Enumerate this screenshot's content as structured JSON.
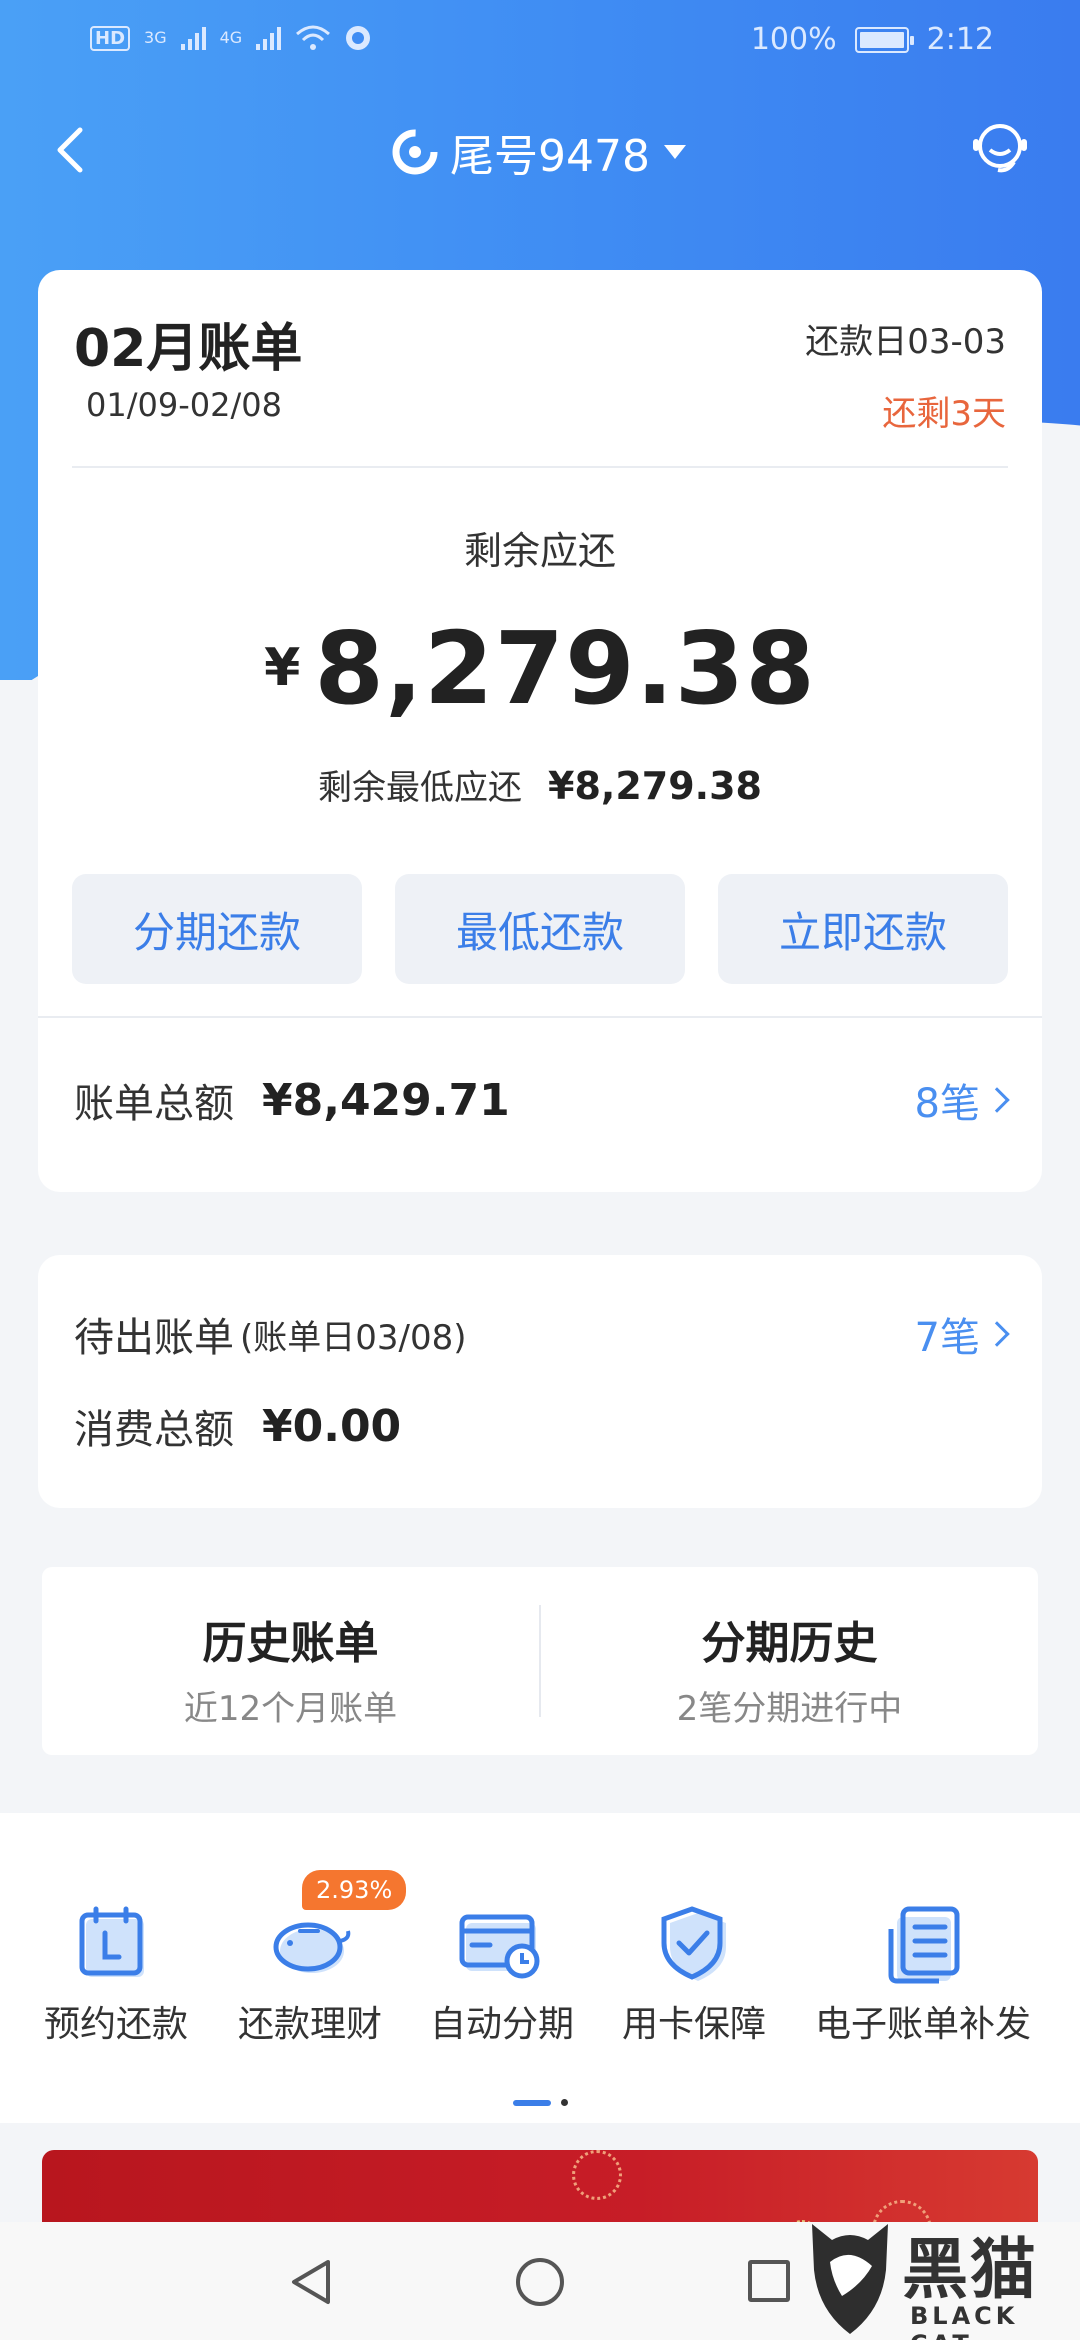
{
  "status_bar": {
    "hd": "HD",
    "net1": "3G",
    "net2": "4G",
    "battery": "100%",
    "time": "2:12"
  },
  "header": {
    "title": "尾号9478"
  },
  "bill": {
    "title": "02月账单",
    "range": "01/09-02/08",
    "due_date": "还款日03-03",
    "days_left": "还剩3天",
    "remain_label": "剩余应还",
    "currency": "¥",
    "remain_amount": "8,279.38",
    "min_label": "剩余最低应还",
    "min_amount": "¥8,279.38",
    "actions": [
      "分期还款",
      "最低还款",
      "立即还款"
    ],
    "total_label": "账单总额",
    "total_amount": "¥8,429.71",
    "total_count": "8笔"
  },
  "pending": {
    "label": "待出账单",
    "statement_day": "(账单日03/08)",
    "count": "7笔",
    "spend_label": "消费总额",
    "spend_amount": "¥0.00"
  },
  "history": [
    {
      "title": "历史账单",
      "sub": "近12个月账单"
    },
    {
      "title": "分期历史",
      "sub": "2笔分期进行中"
    }
  ],
  "tools": {
    "badge": "2.93%",
    "items": [
      {
        "label": "预约还款",
        "icon": "calendar-icon"
      },
      {
        "label": "还款理财",
        "icon": "piggy-bank-icon"
      },
      {
        "label": "自动分期",
        "icon": "card-clock-icon"
      },
      {
        "label": "用卡保障",
        "icon": "shield-check-icon"
      },
      {
        "label": "电子账单补发",
        "icon": "document-icon"
      }
    ],
    "page_indicator": {
      "current": 1,
      "total": 2
    }
  },
  "watermark": {
    "text": "黑猫",
    "sub": "BLACK CAT"
  },
  "colors": {
    "accent": "#3b7ee8",
    "warning": "#e8663d",
    "badge": "#f5762f",
    "banner": "#c71d27"
  }
}
